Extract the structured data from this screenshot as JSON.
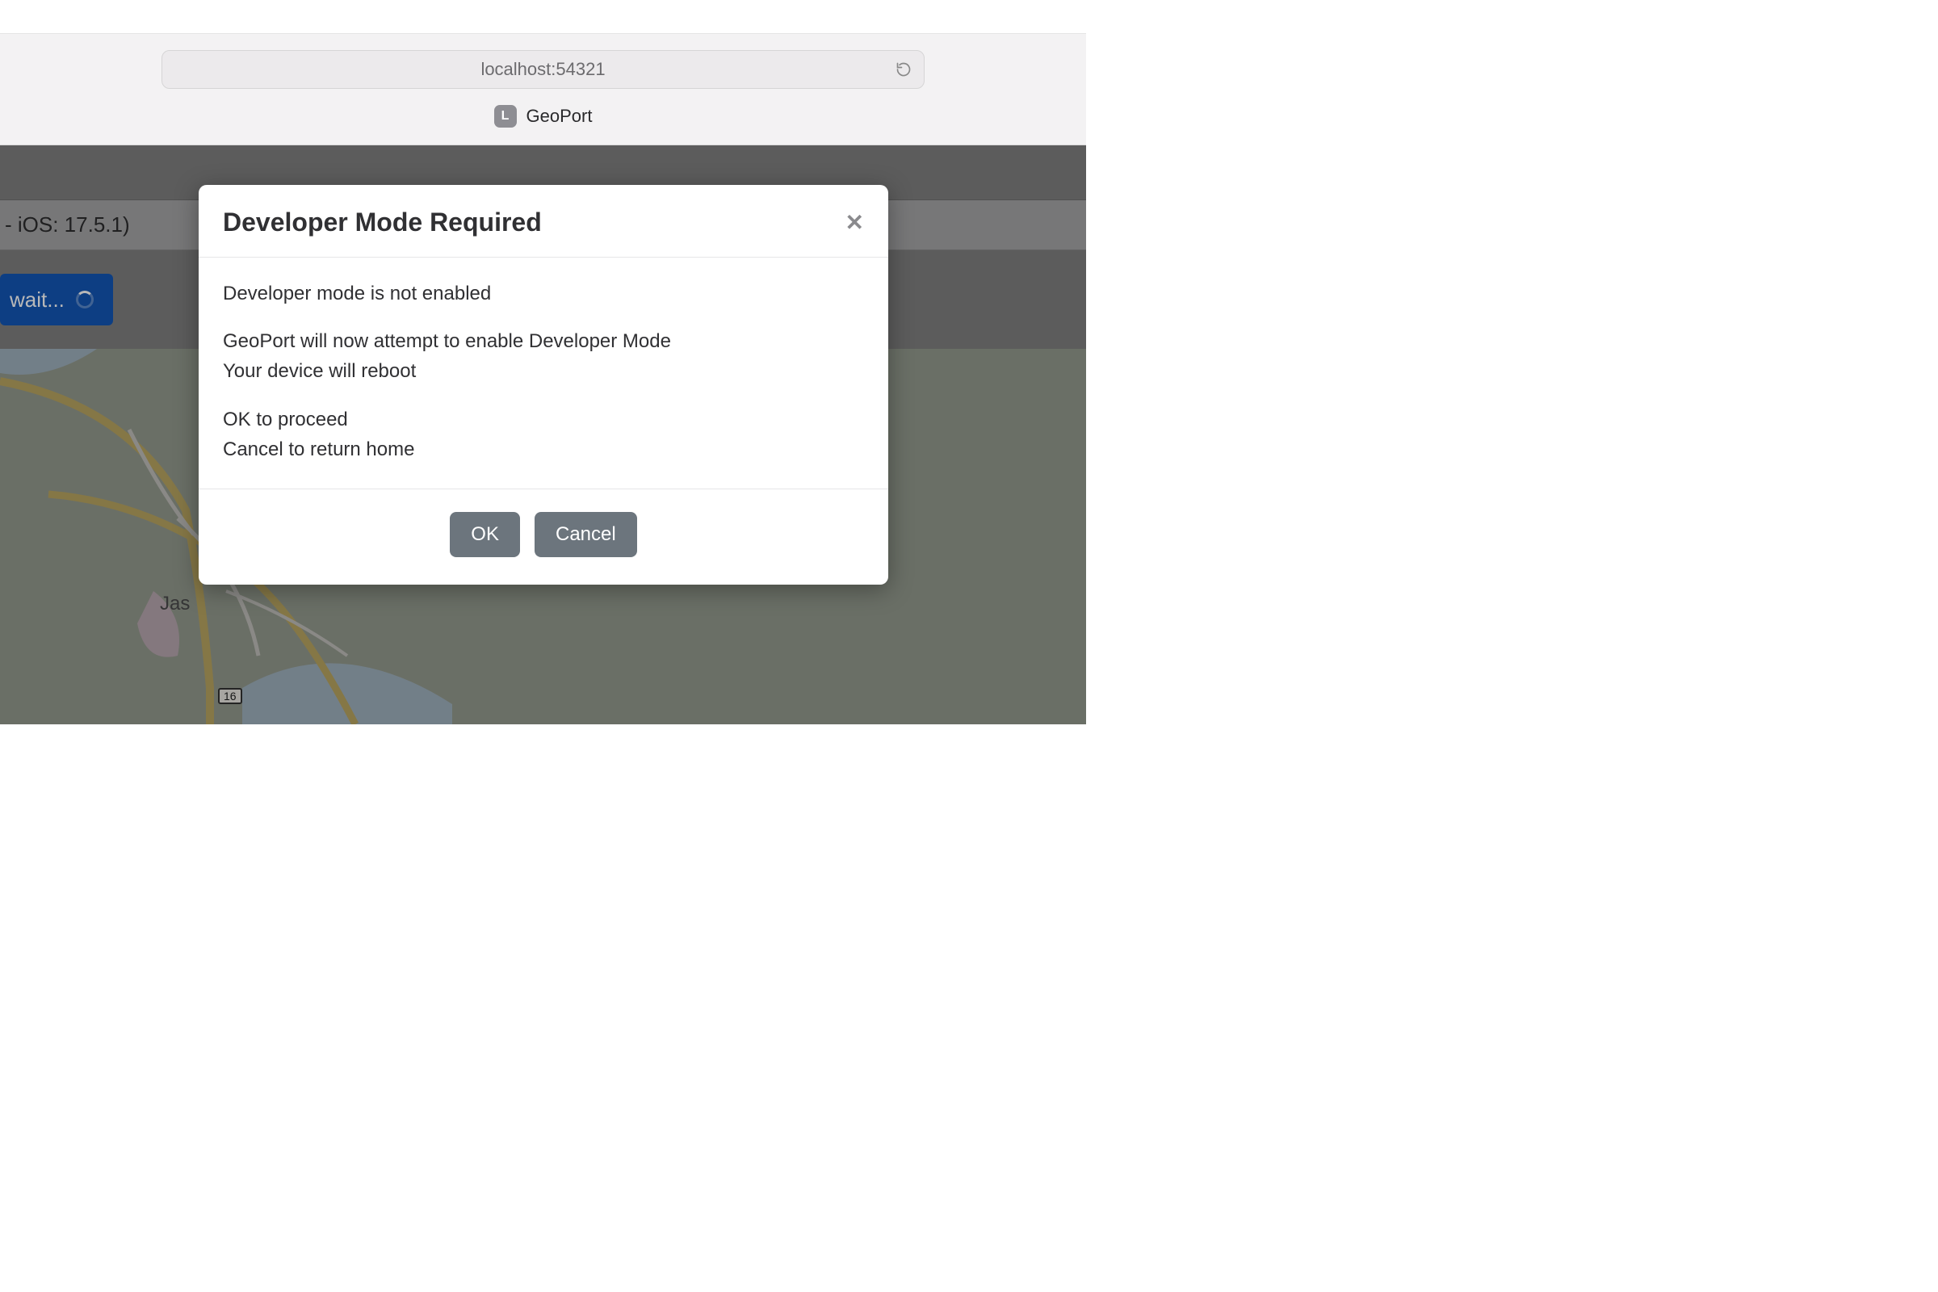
{
  "browser": {
    "url": "localhost:54321",
    "tab": {
      "badge": "L",
      "title": "GeoPort"
    }
  },
  "device_row": "- iOS: 17.5.1)",
  "wait_button": "wait...",
  "map": {
    "city_label": "Jas",
    "route_label": "16"
  },
  "modal": {
    "title": "Developer Mode Required",
    "lines": {
      "l1": "Developer mode is not enabled",
      "l2": "GeoPort will now attempt to enable Developer Mode",
      "l3": "Your device will reboot",
      "l4": "OK to proceed",
      "l5": "Cancel to return home"
    },
    "ok_label": "OK",
    "cancel_label": "Cancel"
  }
}
